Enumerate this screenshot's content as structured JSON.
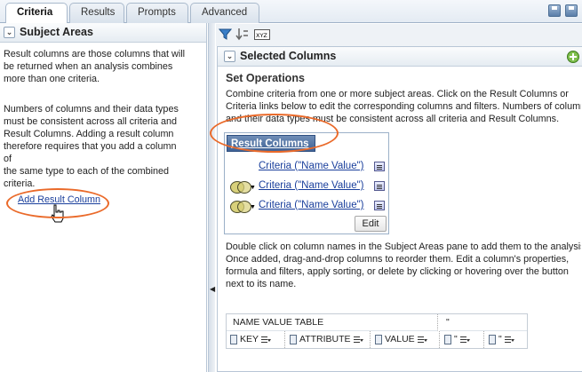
{
  "tabs": [
    {
      "label": "Criteria",
      "active": true
    },
    {
      "label": "Results",
      "active": false
    },
    {
      "label": "Prompts",
      "active": false
    },
    {
      "label": "Advanced",
      "active": false
    }
  ],
  "left_pane": {
    "title": "Subject Areas",
    "paragraph1_lines": [
      "Result columns are those columns that will",
      "be returned when an analysis combines",
      "more than one criteria."
    ],
    "paragraph2_lines": [
      "Numbers of columns and their data types",
      "must be consistent across all criteria and",
      "Result Columns. Adding a result column",
      "therefore requires that you add a column of",
      "the same type to each of the combined",
      "criteria."
    ],
    "add_link": "Add Result Column"
  },
  "right_pane": {
    "title": "Selected Columns",
    "section_title": "Set Operations",
    "intro_lines": [
      "Combine criteria from one or more subject areas. Click on the Result Columns or",
      "Criteria links below to edit the corresponding columns and filters. Numbers of column",
      "and their data types must be consistent across all criteria and Result Columns."
    ],
    "result_columns_label": "Result Columns",
    "criteria": [
      {
        "label": "Criteria (\"Name Value\")",
        "has_set_icon": false
      },
      {
        "label": "Criteria (\"Name Value\")",
        "has_set_icon": true
      },
      {
        "label": "Criteria (\"Name Value\")",
        "has_set_icon": true
      }
    ],
    "edit_button": "Edit",
    "help_lines": [
      "Double click on column names in the Subject Areas pane to add them to the analysis",
      "Once added, drag-and-drop columns to reorder them. Edit a column's properties,",
      "formula and filters, apply sorting, or delete by clicking or hovering over the button",
      "next to its name."
    ],
    "table": {
      "title": "NAME VALUE TABLE",
      "quote_cell": "\"",
      "columns": [
        "KEY",
        "ATTRIBUTE",
        "VALUE",
        "\"",
        "\""
      ]
    }
  },
  "colors": {
    "accent_orange": "#ea6a2a",
    "link_blue": "#1a3f9c",
    "result_columns_bg": "#4f70a3"
  },
  "icons": [
    "save-icon",
    "save-as-icon",
    "filter-icon",
    "sort-icon",
    "xyz-icon",
    "add-icon",
    "chevron-down-icon",
    "set-operation-icon",
    "column-menu-icon",
    "hand-cursor-icon"
  ]
}
